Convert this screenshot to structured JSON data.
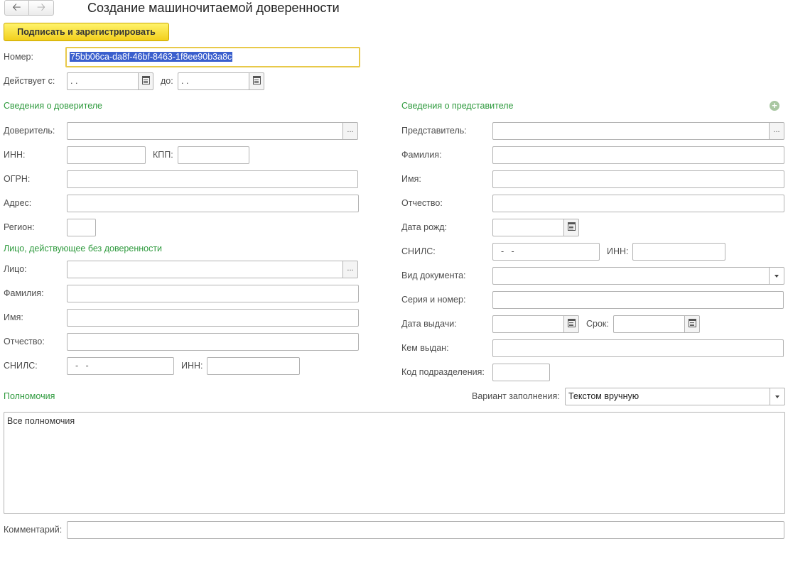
{
  "header": {
    "back_icon": "arrow-left-icon",
    "forward_icon": "arrow-right-icon",
    "title": "Создание машиночитаемой доверенности"
  },
  "toolbar": {
    "sign_register_label": "Подписать и зарегистрировать"
  },
  "number": {
    "label": "Номер:",
    "value": "75bb06ca-da8f-46bf-8463-1f8ee90b3a8c"
  },
  "validity": {
    "from_label": "Действует с:",
    "from_value": " .  .",
    "to_label": "до:",
    "to_value": " .  ."
  },
  "principal": {
    "section_title": "Сведения о доверителе",
    "principal_label": "Доверитель:",
    "principal_value": "",
    "inn_label": "ИНН:",
    "inn_value": "",
    "kpp_label": "КПП:",
    "kpp_value": "",
    "ogrn_label": "ОГРН:",
    "ogrn_value": "",
    "address_label": "Адрес:",
    "address_value": "",
    "region_label": "Регион:",
    "region_value": ""
  },
  "acting_person": {
    "section_title": "Лицо, действующее без доверенности",
    "person_label": "Лицо:",
    "person_value": "",
    "surname_label": "Фамилия:",
    "surname_value": "",
    "name_label": "Имя:",
    "name_value": "",
    "patronymic_label": "Отчество:",
    "patronymic_value": "",
    "snils_label": "СНИЛС:",
    "snils_value": "  -   -",
    "inn_label": "ИНН:",
    "inn_value": ""
  },
  "representative": {
    "section_title": "Сведения о представителе",
    "add_icon": "plus-circle-icon",
    "rep_label": "Представитель:",
    "rep_value": "",
    "surname_label": "Фамилия:",
    "surname_value": "",
    "name_label": "Имя:",
    "name_value": "",
    "patronymic_label": "Отчество:",
    "patronymic_value": "",
    "birth_label": "Дата рожд:",
    "birth_value": " .  .",
    "snils_label": "СНИЛС:",
    "snils_value": "  -   -",
    "inn_label": "ИНН:",
    "inn_value": "",
    "doc_type_label": "Вид документа:",
    "doc_type_value": "",
    "series_label": "Серия и номер:",
    "series_value": "",
    "issue_date_label": "Дата выдачи:",
    "issue_date_value": " .  .",
    "term_label": "Срок:",
    "term_value": " .  .",
    "issued_by_label": "Кем выдан:",
    "issued_by_value": "",
    "dept_code_label": "Код подразделения:",
    "dept_code_value": ""
  },
  "powers": {
    "section_title": "Полномочия",
    "fill_variant_label": "Вариант заполнения:",
    "fill_variant_value": "Текстом вручную",
    "text": "Все полномочия"
  },
  "comment": {
    "label": "Комментарий:",
    "value": ""
  },
  "colors": {
    "section": "#2e9a3d",
    "accent_yellow": "#f2cf1c",
    "focus_border": "#e8c94a",
    "selection": "#3a5fcd"
  }
}
